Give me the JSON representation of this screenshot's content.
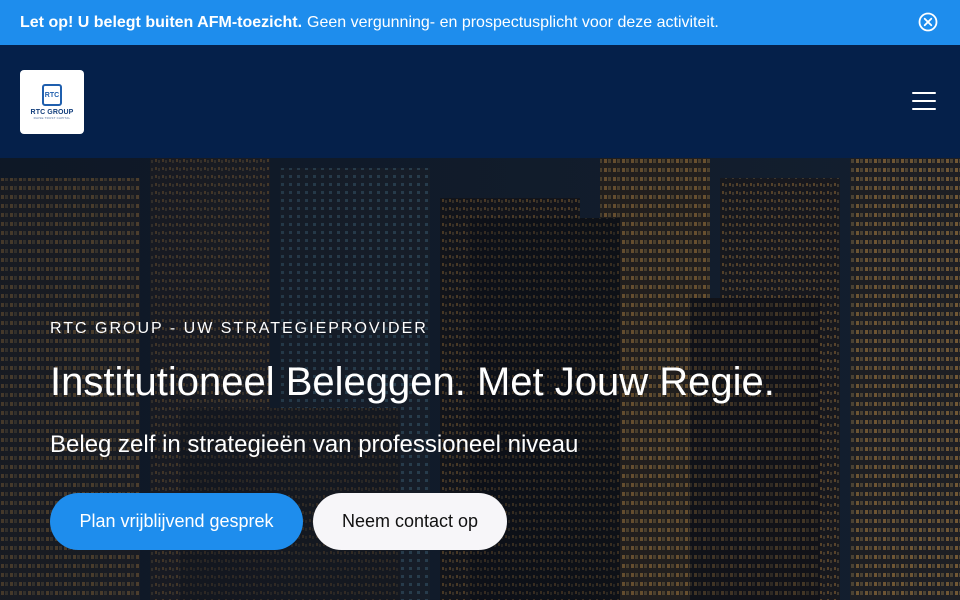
{
  "notice": {
    "strong_text": "Let op! U belegt buiten AFM-toezicht.",
    "text": "Geen vergunning- en prospectusplicht voor deze activiteit.",
    "close_icon": "circle-x-icon"
  },
  "header": {
    "logo": {
      "badge_text": "RTC",
      "brand_text": "RTC GROUP",
      "sub_text": "RAISE TRUST CAPITAL"
    },
    "menu_icon": "hamburger-menu-icon"
  },
  "hero": {
    "eyebrow": "RTC GROUP - UW STRATEGIEPROVIDER",
    "title": "Institutioneel Beleggen. Met Jouw Regie.",
    "subtitle": "Beleg zelf in strategieën van professioneel niveau",
    "primary_button": "Plan vrijblijvend gesprek",
    "secondary_button": "Neem contact op"
  },
  "colors": {
    "notice_bg": "#1e8ded",
    "header_bg": "#05204a",
    "primary": "#1e8ded",
    "secondary_bg": "#f7f6f9"
  }
}
